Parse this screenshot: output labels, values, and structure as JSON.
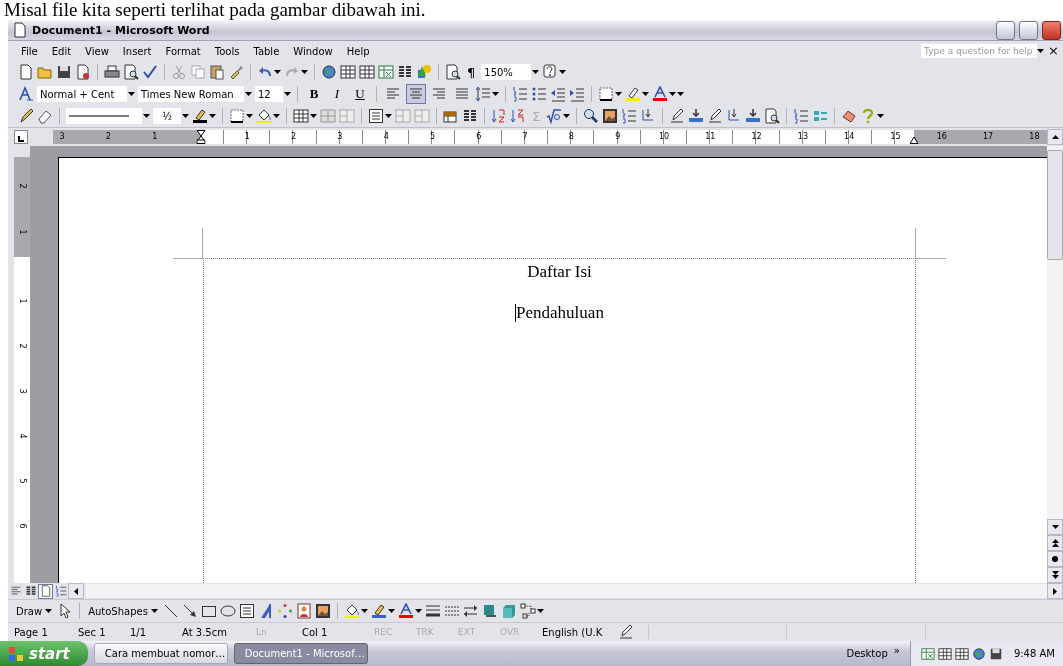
{
  "caption": "Misal file kita seperti terlihat pada gambar dibawah ini.",
  "window": {
    "title": "Document1 - Microsoft Word"
  },
  "menu": [
    "File",
    "Edit",
    "View",
    "Insert",
    "Format",
    "Tools",
    "Table",
    "Window",
    "Help"
  ],
  "help_box": {
    "placeholder": "Type a question for help",
    "close": "×"
  },
  "standard_toolbar": {
    "pilcrow": "¶",
    "zoom": "150%"
  },
  "formatting_toolbar": {
    "style": "Normal + Cent",
    "font": "Times New Roman",
    "size": "12",
    "bold": "B",
    "italic": "I",
    "underline": "U",
    "alignment": [
      {
        "selected": false
      },
      {
        "selected": true
      },
      {
        "selected": false
      },
      {
        "selected": false
      }
    ]
  },
  "tables_toolbar": {
    "line_weight": "½",
    "sum": "Σ"
  },
  "ruler": {
    "left_labels": [
      "3",
      "2",
      "1"
    ],
    "right_labels": [
      "1",
      "2",
      "3",
      "4",
      "5",
      "6",
      "7",
      "8",
      "9",
      "10",
      "11",
      "12",
      "13",
      "14",
      "15",
      "16",
      "17",
      "18"
    ]
  },
  "vertical_ruler": {
    "top_labels": [
      "2",
      "1"
    ],
    "bottom_labels": [
      "1",
      "2",
      "3",
      "4",
      "5",
      "6"
    ]
  },
  "document": {
    "heading": "Daftar Isi",
    "paragraph": "Pendahuluan"
  },
  "view_buttons": [
    {
      "selected": false
    },
    {
      "selected": false
    },
    {
      "selected": true
    },
    {
      "selected": false
    }
  ],
  "drawing_toolbar": {
    "draw": "Draw",
    "autoshapes": "AutoShapes"
  },
  "status_bar": [
    {
      "text": "Page 1",
      "disabled": false
    },
    {
      "text": "Sec 1",
      "disabled": false
    },
    {
      "text": "1/1",
      "disabled": false
    },
    {
      "text": "At 3.5cm",
      "disabled": false
    },
    {
      "text": "Ln",
      "disabled": true
    },
    {
      "text": "Col 1",
      "disabled": false
    },
    {
      "text": "REC",
      "disabled": true
    },
    {
      "text": "TRK",
      "disabled": true
    },
    {
      "text": "EXT",
      "disabled": true
    },
    {
      "text": "OVR",
      "disabled": true
    },
    {
      "text": "English (U.K",
      "disabled": false
    }
  ],
  "taskbar": {
    "start": "start",
    "tasks": [
      {
        "label": "Cara membuat nomor…",
        "selected": false
      },
      {
        "label": "Document1 - Microsof…",
        "selected": true
      }
    ],
    "desktop": "Desktop",
    "chevron": "»",
    "clock": "9:48 AM"
  }
}
